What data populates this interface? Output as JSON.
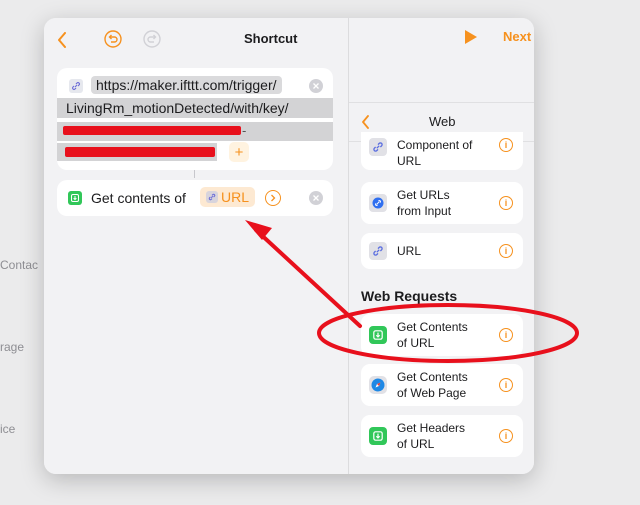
{
  "background": {
    "labels": [
      "Contac",
      "rage",
      "ice"
    ]
  },
  "editor": {
    "title": "Shortcut",
    "next_label": "Next",
    "url_action": {
      "line1": "https://maker.ifttt.com/trigger/",
      "line2": "LivingRm_motionDetected/with/key/",
      "dash": "-",
      "add_symbol": "+"
    },
    "get_contents_action": {
      "label": "Get contents of",
      "token": "URL"
    }
  },
  "panel": {
    "title": "Web",
    "items_top": [
      {
        "label": "Component of\nURL",
        "icon": "link-icon"
      },
      {
        "label": "Get URLs\nfrom Input",
        "icon": "link-icon"
      },
      {
        "label": "URL",
        "icon": "link-icon"
      }
    ],
    "section_title": "Web Requests",
    "items_requests": [
      {
        "label": "Get Contents\nof URL",
        "icon": "download-icon"
      },
      {
        "label": "Get Contents\nof Web Page",
        "icon": "safari-icon"
      },
      {
        "label": "Get Headers\nof URL",
        "icon": "download-icon"
      }
    ],
    "info_symbol": "i"
  },
  "colors": {
    "accent": "#f6911e",
    "annotation": "#e8101c",
    "action_green": "#31c759"
  }
}
